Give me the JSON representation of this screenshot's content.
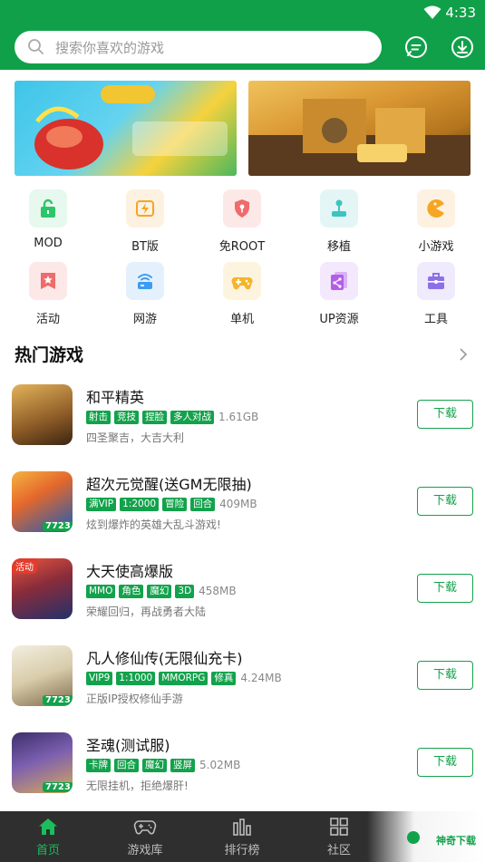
{
  "status_bar": {
    "time": "4:33"
  },
  "search": {
    "placeholder": "搜索你喜欢的游戏"
  },
  "categories": [
    {
      "label": "MOD",
      "icon": "lock-open-icon",
      "color": "#2cc56a",
      "bg": "#e7f8ee"
    },
    {
      "label": "BT版",
      "icon": "lightning-icon",
      "color": "#f5a623",
      "bg": "#fdf1e1"
    },
    {
      "label": "免ROOT",
      "icon": "shield-key-icon",
      "color": "#f06b6b",
      "bg": "#fde8e8"
    },
    {
      "label": "移植",
      "icon": "joystick-icon",
      "color": "#3ec3c0",
      "bg": "#e3f6f5"
    },
    {
      "label": "小游戏",
      "icon": "pacman-icon",
      "color": "#f6a623",
      "bg": "#fdf1e1"
    },
    {
      "label": "活动",
      "icon": "star-flag-icon",
      "color": "#f06b6b",
      "bg": "#fde8e8"
    },
    {
      "label": "网游",
      "icon": "network-icon",
      "color": "#3b9cf2",
      "bg": "#e4f1fd"
    },
    {
      "label": "单机",
      "icon": "gamepad-icon",
      "color": "#f5b52a",
      "bg": "#fdf4e0"
    },
    {
      "label": "UP资源",
      "icon": "share-icon",
      "color": "#b45ee8",
      "bg": "#f3e8fc"
    },
    {
      "label": "工具",
      "icon": "toolbox-icon",
      "color": "#8d70e8",
      "bg": "#efeafc"
    }
  ],
  "hot_section": {
    "title": "热门游戏"
  },
  "games": [
    {
      "name": "和平精英",
      "tags": [
        "射击",
        "竞技",
        "捏脸",
        "多人对战"
      ],
      "size": "1.61GB",
      "desc": "四圣聚吉，大吉大利",
      "button": "下载",
      "icon_badge": "",
      "icon_brand": "",
      "icon_colors": [
        "#d89b3a",
        "#7a4a1e"
      ]
    },
    {
      "name": "超次元觉醒(送GM无限抽)",
      "tags": [
        "满VIP",
        "1:2000",
        "冒险",
        "回合"
      ],
      "size": "409MB",
      "desc": "炫到爆炸的英雄大乱斗游戏!",
      "button": "下载",
      "icon_badge": "",
      "icon_brand": "7723",
      "icon_colors": [
        "#f2a33a",
        "#1b5fb8"
      ]
    },
    {
      "name": "大天使高爆版",
      "tags": [
        "MMO",
        "角色",
        "魔幻",
        "3D"
      ],
      "size": "458MB",
      "desc": "荣耀回归，再战勇者大陆",
      "button": "下载",
      "icon_badge": "活动",
      "icon_brand": "",
      "icon_colors": [
        "#e2523b",
        "#24305e"
      ]
    },
    {
      "name": "凡人修仙传(无限仙充卡)",
      "tags": [
        "VIP9",
        "1:1000",
        "MMORPG",
        "修真"
      ],
      "size": "4.24MB",
      "desc": "正版IP授权修仙手游",
      "button": "下载",
      "icon_badge": "",
      "icon_brand": "7723",
      "icon_colors": [
        "#e9e2cf",
        "#8a7453"
      ]
    },
    {
      "name": "圣魂(测试服)",
      "tags": [
        "卡牌",
        "回合",
        "魔幻",
        "竖屏"
      ],
      "size": "5.02MB",
      "desc": "无限挂机，拒绝爆肝!",
      "button": "下载",
      "icon_badge": "",
      "icon_brand": "7723",
      "icon_colors": [
        "#5a4a8c",
        "#d7a85a"
      ]
    }
  ],
  "bottom_nav": [
    {
      "label": "首页",
      "icon": "home-icon",
      "active": true
    },
    {
      "label": "游戏库",
      "icon": "gamepad-icon",
      "active": false
    },
    {
      "label": "排行榜",
      "icon": "bar-chart-icon",
      "active": false
    },
    {
      "label": "社区",
      "icon": "grid-icon",
      "active": false
    }
  ],
  "watermark": {
    "text": "神奇下载"
  },
  "colors": {
    "brand_green": "#11a04a",
    "nav_bg": "#2f2f2f"
  }
}
